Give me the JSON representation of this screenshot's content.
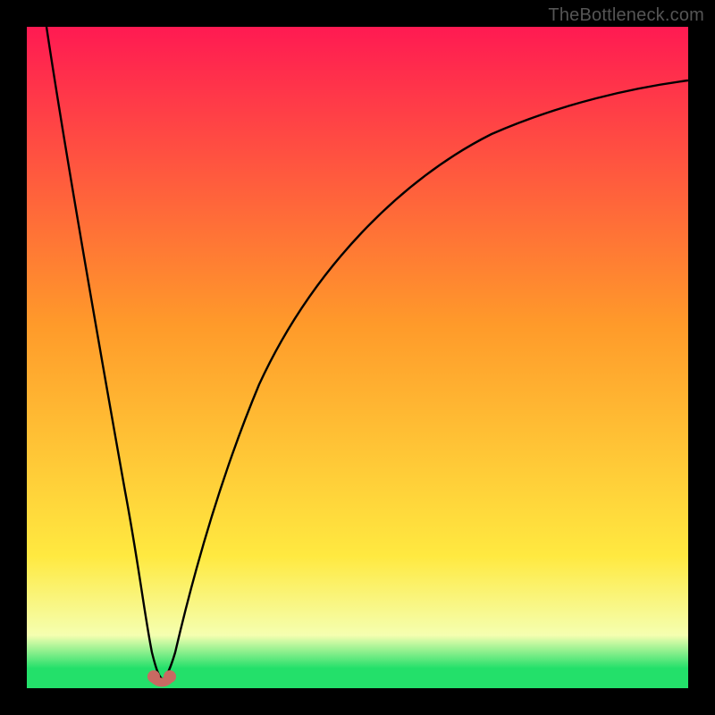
{
  "attribution": "TheBottleneck.com",
  "colors": {
    "top": "#ff1a52",
    "orange": "#ff9a2a",
    "yellow": "#ffe940",
    "light": "#f5ffb0",
    "green": "#23e06a",
    "curve": "#000000",
    "marker": "#c86a62"
  },
  "chart_data": {
    "type": "line",
    "title": "",
    "xlabel": "",
    "ylabel": "",
    "xlim": [
      0,
      100
    ],
    "ylim": [
      0,
      100
    ],
    "grid": false,
    "legend": false,
    "series": [
      {
        "name": "bottleneck-curve",
        "x": [
          3,
          5,
          8,
          11,
          14,
          16,
          18,
          19,
          20,
          21,
          23,
          27,
          32,
          40,
          50,
          60,
          70,
          80,
          90,
          100
        ],
        "y": [
          100,
          80,
          58,
          40,
          24,
          12,
          4,
          1,
          0,
          1,
          5,
          18,
          35,
          55,
          70,
          80,
          86,
          90,
          93,
          95
        ]
      }
    ],
    "annotations": [
      {
        "name": "min-marker-left",
        "x": 19,
        "y": 1
      },
      {
        "name": "min-marker-right",
        "x": 21,
        "y": 1
      }
    ]
  }
}
